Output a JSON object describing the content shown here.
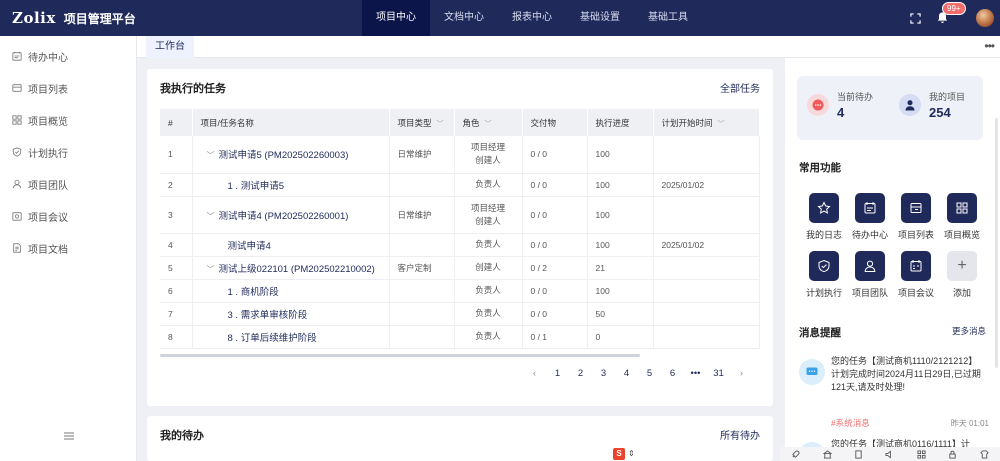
{
  "app": {
    "logo": "Zolix",
    "title": "项目管理平台"
  },
  "topnav": [
    {
      "label": "项目中心",
      "active": true
    },
    {
      "label": "文档中心",
      "active": false
    },
    {
      "label": "报表中心",
      "active": false
    },
    {
      "label": "基础设置",
      "active": false
    },
    {
      "label": "基础工具",
      "active": false
    }
  ],
  "notifications": {
    "badge": "99+"
  },
  "sidebar": {
    "items": [
      {
        "label": "待办中心",
        "icon": "todo-icon"
      },
      {
        "label": "项目列表",
        "icon": "list-icon"
      },
      {
        "label": "项目概览",
        "icon": "grid-icon"
      },
      {
        "label": "计划执行",
        "icon": "shield-icon"
      },
      {
        "label": "项目团队",
        "icon": "user-icon"
      },
      {
        "label": "项目会议",
        "icon": "meeting-icon"
      },
      {
        "label": "项目文档",
        "icon": "document-icon"
      }
    ]
  },
  "tabs": {
    "active": "工作台",
    "more": "•••"
  },
  "tasks": {
    "title": "我执行的任务",
    "all_link": "全部任务",
    "columns": [
      "#",
      "项目/任务名称",
      "项目类型",
      "角色",
      "交付物",
      "执行进度",
      "计划开始时间"
    ],
    "rows": [
      {
        "no": "1",
        "name": "测试申请5 (PM202502260003)",
        "expand": true,
        "type": "日常维护",
        "role": "项目经理\n创建人",
        "deliverable": "0 / 0",
        "progress": "100",
        "start": ""
      },
      {
        "no": "2",
        "name": "1 . 测试申请5",
        "expand": false,
        "type": "",
        "role": "负责人",
        "deliverable": "0 / 0",
        "progress": "100",
        "start": "2025/01/02"
      },
      {
        "no": "3",
        "name": "测试申请4 (PM202502260001)",
        "expand": true,
        "type": "日常维护",
        "role": "项目经理\n创建人",
        "deliverable": "0 / 0",
        "progress": "100",
        "start": ""
      },
      {
        "no": "4",
        "name": "测试申请4",
        "expand": false,
        "type": "",
        "role": "负责人",
        "deliverable": "0 / 0",
        "progress": "100",
        "start": "2025/01/02"
      },
      {
        "no": "5",
        "name": "测试上级022101 (PM202502210002)",
        "expand": true,
        "type": "客户定制",
        "role": "创建人",
        "deliverable": "0 / 2",
        "progress": "21",
        "start": ""
      },
      {
        "no": "6",
        "name": "1 . 商机阶段",
        "expand": false,
        "type": "",
        "role": "负责人",
        "deliverable": "0 / 0",
        "progress": "100",
        "start": ""
      },
      {
        "no": "7",
        "name": "3 . 需求单审核阶段",
        "expand": false,
        "type": "",
        "role": "负责人",
        "deliverable": "0 / 0",
        "progress": "50",
        "start": ""
      },
      {
        "no": "8",
        "name": "8 . 订单后续维护阶段",
        "expand": false,
        "type": "",
        "role": "负责人",
        "deliverable": "0 / 1",
        "progress": "0",
        "start": ""
      }
    ],
    "pagination": [
      "1",
      "2",
      "3",
      "4",
      "5",
      "6",
      "•••",
      "31"
    ]
  },
  "todo": {
    "title": "我的待办",
    "all_link": "所有待办"
  },
  "stats": {
    "pending_label": "当前待办",
    "pending_value": "4",
    "projects_label": "我的项目",
    "projects_value": "254"
  },
  "functions": {
    "title": "常用功能",
    "items": [
      {
        "label": "我的日志",
        "icon": "star-icon"
      },
      {
        "label": "待办中心",
        "icon": "todo-icon"
      },
      {
        "label": "项目列表",
        "icon": "list-icon"
      },
      {
        "label": "项目概览",
        "icon": "grid-icon"
      },
      {
        "label": "计划执行",
        "icon": "shield-icon"
      },
      {
        "label": "项目团队",
        "icon": "user-icon"
      },
      {
        "label": "项目会议",
        "icon": "meeting-icon"
      },
      {
        "label": "添加",
        "icon": "plus-icon"
      }
    ]
  },
  "messages": {
    "title": "消息提醒",
    "more": "更多消息",
    "items": [
      {
        "text": "您的任务【测试商机1110/2121212】计划完成时间2024月11日29日,已过期121天,请及时处理!",
        "tag": "#系统消息",
        "time": "昨天 01:01"
      },
      {
        "text": "您的任务【测试商机0116/1111】计",
        "tag": "",
        "time": ""
      }
    ]
  },
  "colors": {
    "nav": "#1f2a5a",
    "nav_active": "#0c154a",
    "accent": "#1f2a5a",
    "badge": "#f56c6c"
  }
}
